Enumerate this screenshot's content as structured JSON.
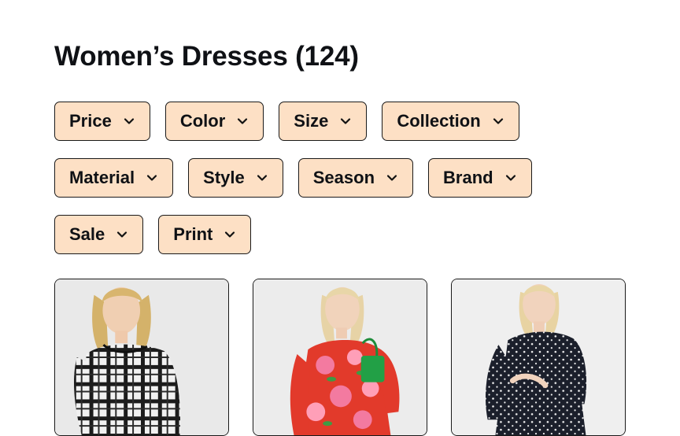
{
  "page": {
    "title": "Women’s Dresses (124)"
  },
  "filters": {
    "row1": [
      {
        "label": "Price"
      },
      {
        "label": "Color"
      },
      {
        "label": "Size"
      },
      {
        "label": "Collection"
      }
    ],
    "row2": [
      {
        "label": "Material"
      },
      {
        "label": "Style"
      },
      {
        "label": "Season"
      },
      {
        "label": "Brand"
      }
    ],
    "row3": [
      {
        "label": "Sale"
      },
      {
        "label": "Print"
      }
    ],
    "chevron_icon": "chevron-down-icon",
    "chip_color": "#fde0c5"
  },
  "products": [
    {
      "image": "black-white-plaid-dress"
    },
    {
      "image": "red-floral-print-dress"
    },
    {
      "image": "navy-polka-dot-dress"
    }
  ]
}
